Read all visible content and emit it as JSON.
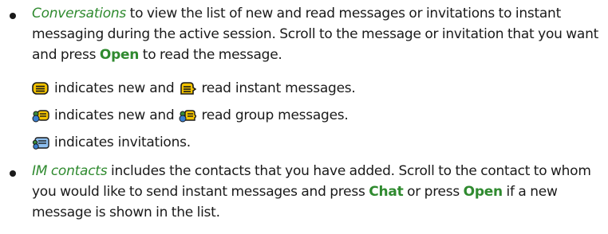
{
  "section1": {
    "term": "Conversations",
    "text_after_term": " to view the list of new and read messages or invitations to instant messaging during the active session. Scroll to the message or invitation that you want and press ",
    "key_open": "Open",
    "text_end": " to read the message."
  },
  "icon_lines": {
    "line1": {
      "icon_new": "new-instant-message-icon",
      "text_mid": "indicates new and",
      "icon_read": "read-instant-message-icon",
      "text_end": "read instant messages."
    },
    "line2": {
      "icon_new": "new-group-message-icon",
      "text_mid": "indicates new and",
      "icon_read": "read-group-message-icon",
      "text_end": "read group messages."
    },
    "line3": {
      "icon": "invitation-icon",
      "text": "indicates invitations."
    }
  },
  "section2": {
    "term": "IM contacts",
    "text_after_term": " includes the contacts that you have added. Scroll to the contact to whom you would like to send instant messages and press ",
    "key_chat": "Chat",
    "text_mid": " or press ",
    "key_open": "Open",
    "text_end": " if a new message is shown in the list."
  },
  "colors": {
    "accent_green": "#2f8a2f",
    "text": "#1a1a1a",
    "icon_yellow": "#f2c200",
    "icon_outline": "#1a1a1a",
    "icon_green": "#3a8a3a",
    "icon_blue": "#3a7fd0"
  }
}
